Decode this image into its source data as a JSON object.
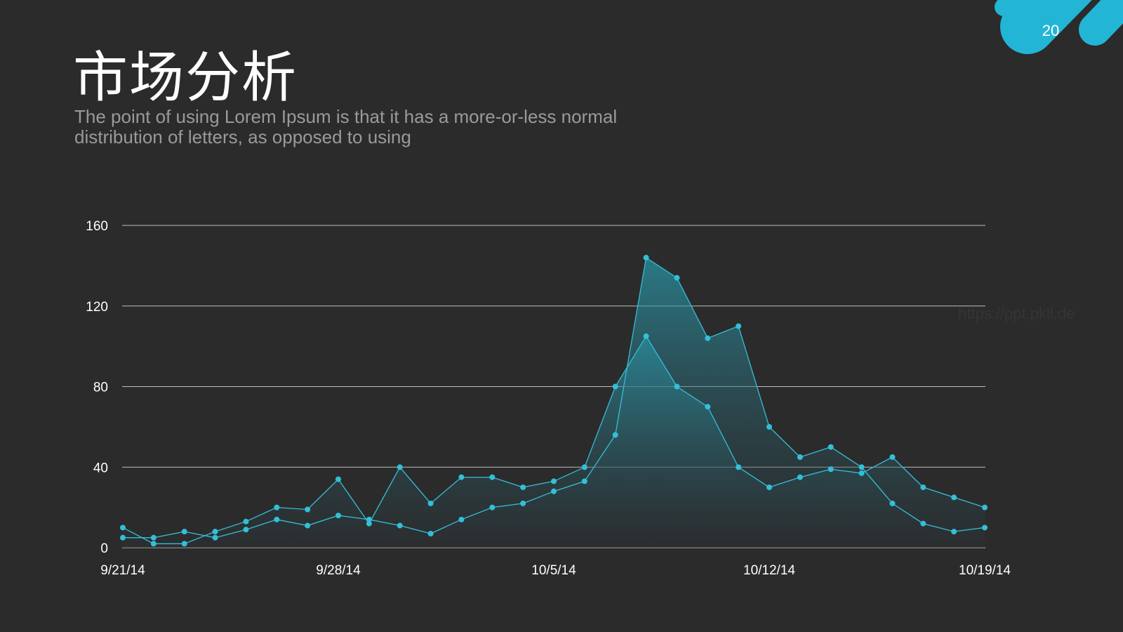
{
  "slide": {
    "title": "市场分析",
    "subtitle_line1": "The point of using Lorem Ipsum is that it has a more-or-less normal",
    "subtitle_line2": "distribution of letters, as opposed to using",
    "page_number": "20",
    "watermark": "https://ppt.pkll.de"
  },
  "colors": {
    "background": "#2b2b2b",
    "accent": "#22b5d6",
    "line": "#33bfd8",
    "fill_top": "#2aa7bc",
    "fill_bottom": "#2c2f33",
    "grid": "#bdbdbd",
    "text": "#ffffff",
    "subtitle": "#9a9a9a"
  },
  "chart_data": {
    "type": "area",
    "x": [
      "9/21/14",
      "9/22/14",
      "9/23/14",
      "9/24/14",
      "9/25/14",
      "9/26/14",
      "9/27/14",
      "9/28/14",
      "9/29/14",
      "9/30/14",
      "10/1/14",
      "10/2/14",
      "10/3/14",
      "10/4/14",
      "10/5/14",
      "10/6/14",
      "10/7/14",
      "10/8/14",
      "10/9/14",
      "10/10/14",
      "10/11/14",
      "10/12/14",
      "10/13/14",
      "10/14/14",
      "10/15/14",
      "10/16/14",
      "10/17/14",
      "10/18/14",
      "10/19/14"
    ],
    "x_tick_labels": [
      "9/21/14",
      "9/28/14",
      "10/5/14",
      "10/12/14",
      "10/19/14"
    ],
    "series": [
      {
        "values": [
          10,
          2,
          2,
          8,
          13,
          20,
          19,
          34,
          12,
          40,
          22,
          35,
          35,
          30,
          33,
          40,
          80,
          105,
          80,
          70,
          40,
          30,
          35,
          39,
          37,
          45,
          30,
          25,
          20
        ]
      },
      {
        "values": [
          5,
          5,
          8,
          5,
          9,
          14,
          11,
          16,
          14,
          11,
          7,
          14,
          20,
          22,
          28,
          33,
          56,
          144,
          134,
          104,
          110,
          60,
          45,
          50,
          40,
          22,
          12,
          8,
          10
        ]
      }
    ],
    "y_ticks": [
      0,
      40,
      80,
      120,
      160
    ],
    "ylim": [
      0,
      160
    ],
    "grid": true,
    "legend": "none",
    "title": "",
    "xlabel": "",
    "ylabel": ""
  }
}
